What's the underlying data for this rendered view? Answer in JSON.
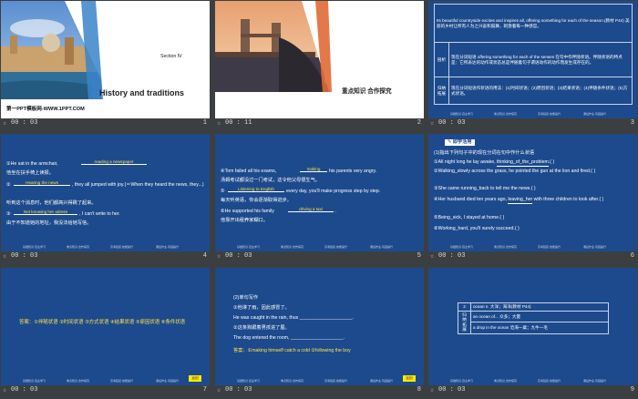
{
  "nav_labels": [
    "基础知识·自主学习",
    "重点知识·合作探究",
    "高考链接·技能提升",
    "课后作业·巩固提升"
  ],
  "slides": [
    {
      "time": "00 : 03",
      "num": "1",
      "section": "Section Ⅳ",
      "title": "History and traditions",
      "footer": "第一PPT模板网-WWW.1PPT.COM"
    },
    {
      "time": "00 : 11",
      "num": "2",
      "heading": "重点知识 合作探究"
    },
    {
      "time": "00 : 03",
      "num": "3",
      "top_text": "Its beautiful countryside excites and inspires all, offering something for each of the season.(教材 P44) 美丽的乡村让所有人为之兴奋和鼓舞，刺激着每一种感官。",
      "label_analysis": "剖析",
      "analysis": "现在分词短语 offering something for each of the senses 在句中作伴随状语。伴随状语的特点是：它所表达的动作或状态总是伴随着句子谓语动作的动作而发生或存在的。",
      "label_summary": "归纳拓展",
      "summary": "现在分词短语作状语的用法：(1)时间状语；(2)原因状语；(3)结果状语；(4)伴随条件状语；(5)方式状语。"
    },
    {
      "time": "00 : 03",
      "num": "4",
      "l1": "①He sat in the armchair,",
      "a1": "reading a newspaper",
      "l1b": "他坐在扶手椅上读报。",
      "l2": "②",
      "a2": "Hearing the news",
      "l2b": ", they all jumped with joy.(＝When they heard the news, they...)",
      "l2c": "听到这个消息时，他们都高兴得跳了起来。",
      "l3": "③",
      "a3": "Not knowing her adress",
      "l3b": ", I can't write to her.",
      "l3c": "由于不知道她的地址，我没法给她写信。"
    },
    {
      "time": "00 : 03",
      "num": "5",
      "l1": "④Tom failed all his exams,",
      "a1": "making",
      "l1b": "his parents very angry.",
      "l1c": "汤姆考试都没过一门考试，这令他父母很生气。",
      "l2": "⑤",
      "a2": "Listening to English",
      "l2b": "every day, you'll make progress step by step.",
      "l2c": "每天听英语，你会逐渐取得进步。",
      "l3": "⑥He supported his family",
      "a3": "driving a taxi",
      "l3b": ".",
      "l3c": "他靠开出租养家糊口。"
    },
    {
      "time": "00 : 03",
      "num": "6",
      "tag": "即学活用",
      "intro": "(1)指出下列句子中的现在分词在句中作什么状语",
      "q1": "①All night long he lay awake, ",
      "q1u": "thinking_of_the_problem",
      "q1e": ".(    )",
      "q2": "②Walking_slowly across the grass, he pointed the gun at the lion and fired.(    )",
      "q3": "③She came running_back to tell me the news.(    )",
      "q4": "④Her husband died ten years ago, ",
      "q4u": "leaving_her",
      "q4e": " with three children to look after.(    )",
      "q5": "⑤Being_sick, I stayed at home.(    )",
      "q6": "⑥Working_hard, you'll surely succeed.(    )"
    },
    {
      "time": "00 : 03",
      "num": "7",
      "answer": "答案：①伴随状语  ②时间状语  ③方式状语  ④结果状语  ⑤原因状语  ⑥条件状语",
      "button": "返回"
    },
    {
      "time": "00 : 03",
      "num": "8",
      "l0": "(2)单句写作",
      "l1": "①他淋了雨，因此感冒了。",
      "l2": "He was caught in the rain, thus ____________________.",
      "l3": "②这条狗跟着男孩进了屋。",
      "l4": "The dog entered the room, ____________________.",
      "answer": "答案：①making himself catch a cold  ②following the boy",
      "button": "返回"
    },
    {
      "time": "00 : 03",
      "num": "9",
      "row_num": "2",
      "row_title": "ocean n. 大洋；海洋(教材 P44)",
      "label": "归纳拓展",
      "e1": "an ocean of... 众多；大量",
      "e2": "a drop in the ocean 沧海一粟；九牛一毛"
    }
  ]
}
